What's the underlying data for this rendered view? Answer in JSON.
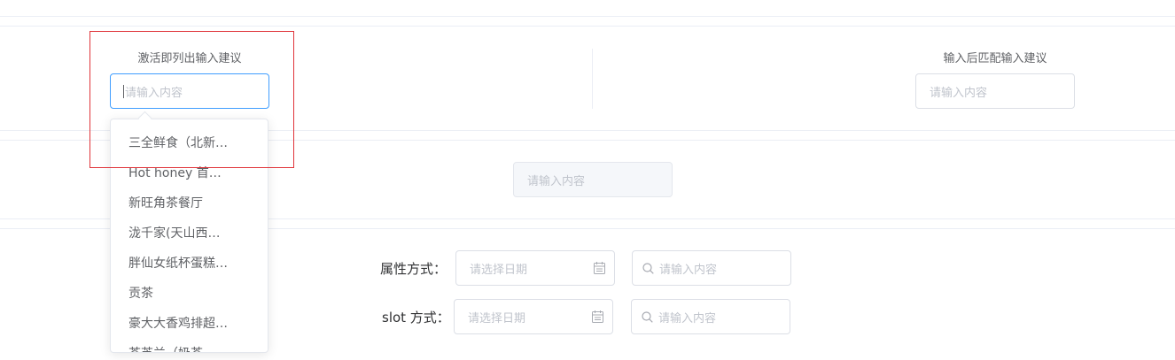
{
  "section1": {
    "left_title": "激活即列出输入建议",
    "left_input_placeholder": "请输入内容",
    "right_title": "输入后匹配输入建议",
    "right_input_placeholder": "请输入内容"
  },
  "dropdown": {
    "items": [
      "三全鲜食（北新泾店）",
      "Hot honey 首尔炸鸡（仙霞路）",
      "新旺角茶餐厅",
      "泷千家(天山西路店)",
      "胖仙女纸杯蛋糕（上海凌空店）",
      "贡茶",
      "豪大大香鸡排超级奶爸",
      "茶芝兰（奶茶，手抓饼）"
    ]
  },
  "section2": {
    "disabled_input_placeholder": "请输入内容"
  },
  "section3": {
    "row1_label": "属性方式：",
    "row1_date_placeholder": "请选择日期",
    "row1_search_placeholder": "请输入内容",
    "row2_label": "slot 方式：",
    "row2_date_placeholder": "请选择日期",
    "row2_search_placeholder": "请输入内容"
  },
  "colors": {
    "focus_border": "#409eff",
    "highlight_box": "#e0343a",
    "placeholder": "#c0c4cc"
  },
  "icons": [
    "calendar-icon",
    "search-icon"
  ]
}
